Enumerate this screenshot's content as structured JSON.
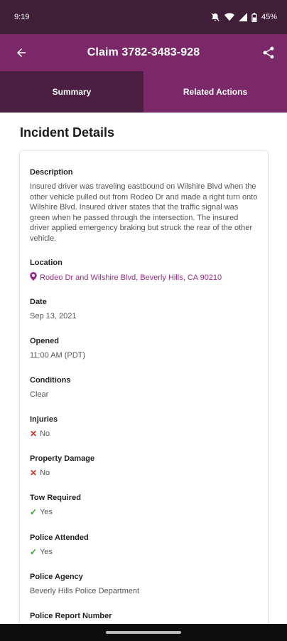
{
  "status_bar": {
    "time": "9:19",
    "battery": "45%",
    "icons": [
      "mute-icon",
      "wifi-icon",
      "signal-icon",
      "battery-icon"
    ]
  },
  "app_bar": {
    "title": "Claim 3782-3483-928",
    "back_icon": "arrow-back-icon",
    "share_icon": "share-icon"
  },
  "tabs": [
    {
      "label": "Summary",
      "active": true
    },
    {
      "label": "Related Actions",
      "active": false
    }
  ],
  "section_title": "Incident Details",
  "details": {
    "description": {
      "label": "Description",
      "value": "Insured driver was traveling eastbound on Wilshire Blvd when the other vehicle pulled out from Rodeo Dr and made a right turn onto Wilshire Blvd. Insured driver states that the traffic signal was green when he passed through the intersection. The insured driver applied emergency braking but struck the rear of the other vehicle."
    },
    "location": {
      "label": "Location",
      "value": "Rodeo Dr and Wilshire Blvd, Beverly Hills, CA 90210",
      "icon": "map-pin-icon"
    },
    "date": {
      "label": "Date",
      "value": "Sep 13, 2021"
    },
    "opened": {
      "label": "Opened",
      "value": "11:00 AM (PDT)"
    },
    "conditions": {
      "label": "Conditions",
      "value": "Clear"
    },
    "injuries": {
      "label": "Injuries",
      "value": "No",
      "glyph": "✕"
    },
    "property_damage": {
      "label": "Property Damage",
      "value": "No",
      "glyph": "✕"
    },
    "tow_required": {
      "label": "Tow Required",
      "value": "Yes",
      "glyph": "✓"
    },
    "police_attended": {
      "label": "Police Attended",
      "value": "Yes",
      "glyph": "✓"
    },
    "police_agency": {
      "label": "Police Agency",
      "value": "Beverly Hills Police Department"
    },
    "police_report_number": {
      "label": "Police Report Number"
    }
  },
  "colors": {
    "status_bar": "#3f1f38",
    "app_bar": "#7a2868",
    "active_tab": "#4a1f42",
    "link": "#9a2a88",
    "no": "#d32f2f",
    "yes": "#2e9e3e"
  }
}
